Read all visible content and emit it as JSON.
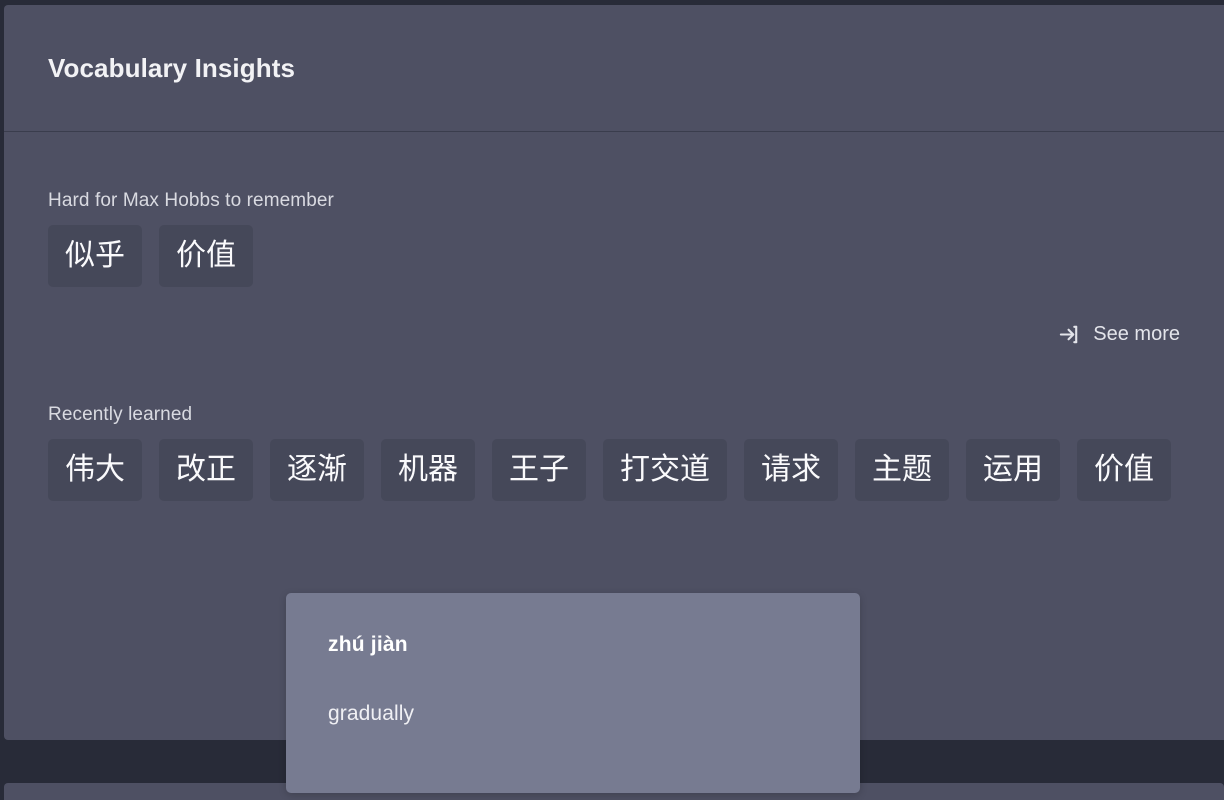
{
  "header": {
    "title": "Vocabulary Insights"
  },
  "sections": {
    "hard": {
      "label": "Hard for Max Hobbs to remember",
      "words": [
        "似乎",
        "价值"
      ]
    },
    "see_more": {
      "label": "See more",
      "icon": "log-in-arrow-icon"
    },
    "recent": {
      "label": "Recently learned",
      "words": [
        "伟大",
        "改正",
        "逐渐",
        "机器",
        "王子",
        "打交道",
        "请求",
        "主题",
        "运用",
        "价值"
      ]
    }
  },
  "tooltip": {
    "pinyin": "zhú jiàn",
    "meaning": "gradually"
  },
  "colors": {
    "page_background": "#282b38",
    "card_background": "#4e5063",
    "chip_background": "#454859",
    "tooltip_background": "#777b91",
    "text_primary": "#f2f2f5",
    "text_secondary": "#d9dae1"
  }
}
